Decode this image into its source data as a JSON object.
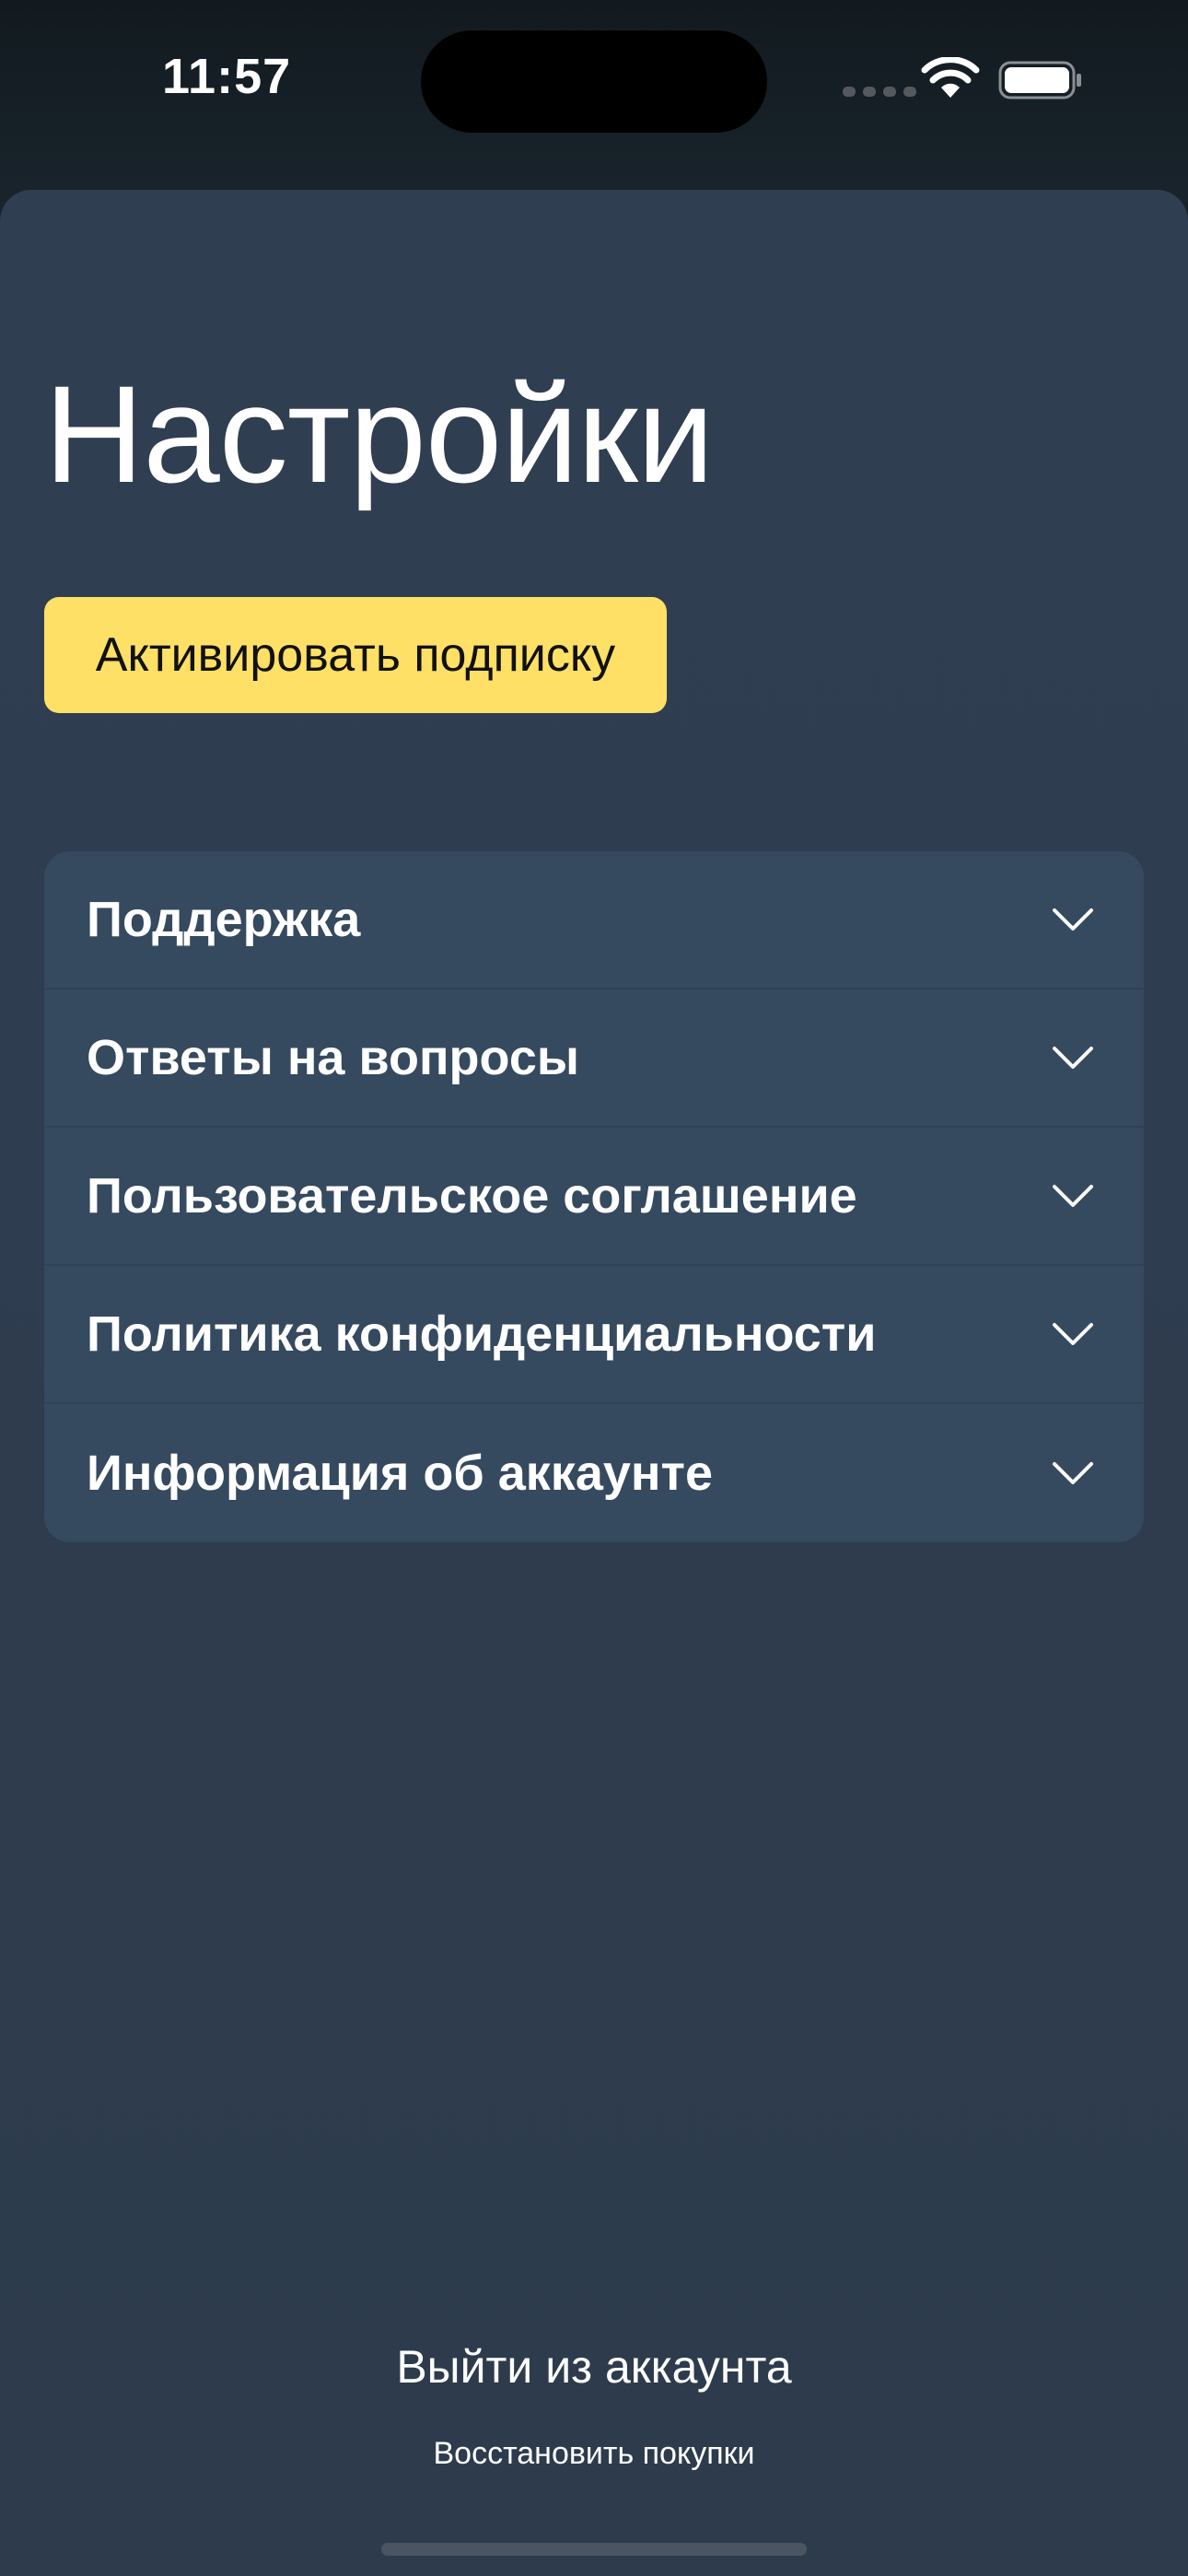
{
  "status_bar": {
    "time": "11:57",
    "icons": [
      "cellular-signal-icon",
      "wifi-icon",
      "battery-icon"
    ]
  },
  "settings": {
    "title": "Настройки",
    "subscribe_label": "Активировать подписку",
    "menu_items": [
      {
        "label": "Поддержка",
        "icon": "chevron-down-icon"
      },
      {
        "label": "Ответы на вопросы",
        "icon": "chevron-down-icon"
      },
      {
        "label": "Пользовательское соглашение",
        "icon": "chevron-down-icon"
      },
      {
        "label": "Политика конфиденциальности",
        "icon": "chevron-down-icon"
      },
      {
        "label": "Информация об аккаунте",
        "icon": "chevron-down-icon"
      }
    ],
    "logout_label": "Выйти из аккаунта",
    "restore_label": "Восстановить покупки"
  },
  "colors": {
    "accent_button": "#ffe066",
    "sheet_background": "#2f3e51",
    "card_background": "#35495f"
  }
}
